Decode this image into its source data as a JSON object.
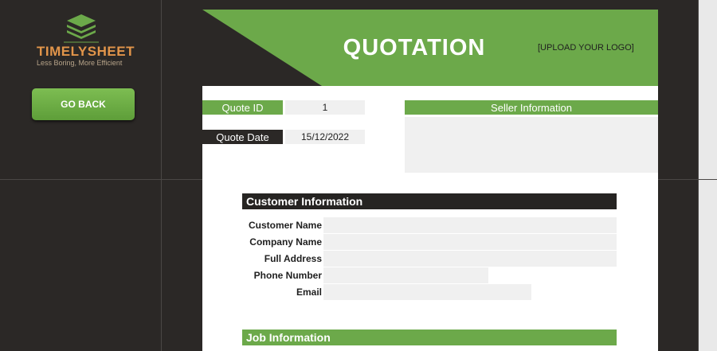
{
  "brand": {
    "name": "TIMELYSHEET",
    "tagline": "Less Boring, More Efficient",
    "primary_color": "#6ca94a",
    "dark_color": "#2b2826",
    "accent_color": "#e2954a"
  },
  "sidebar": {
    "go_back_label": "GO BACK"
  },
  "banner": {
    "title": "QUOTATION",
    "logo_placeholder": "[UPLOAD YOUR LOGO]"
  },
  "quote": {
    "id_label": "Quote ID",
    "id_value": "1",
    "date_label": "Quote Date",
    "date_value": "15/12/2022"
  },
  "seller": {
    "header": "Seller Information",
    "value": ""
  },
  "customer": {
    "header": "Customer Information",
    "fields": [
      {
        "label": "Customer Name",
        "value": ""
      },
      {
        "label": "Company Name",
        "value": ""
      },
      {
        "label": "Full Address",
        "value": ""
      },
      {
        "label": "Phone Number",
        "value": ""
      },
      {
        "label": "Email",
        "value": ""
      }
    ]
  },
  "job": {
    "header": "Job Information"
  }
}
